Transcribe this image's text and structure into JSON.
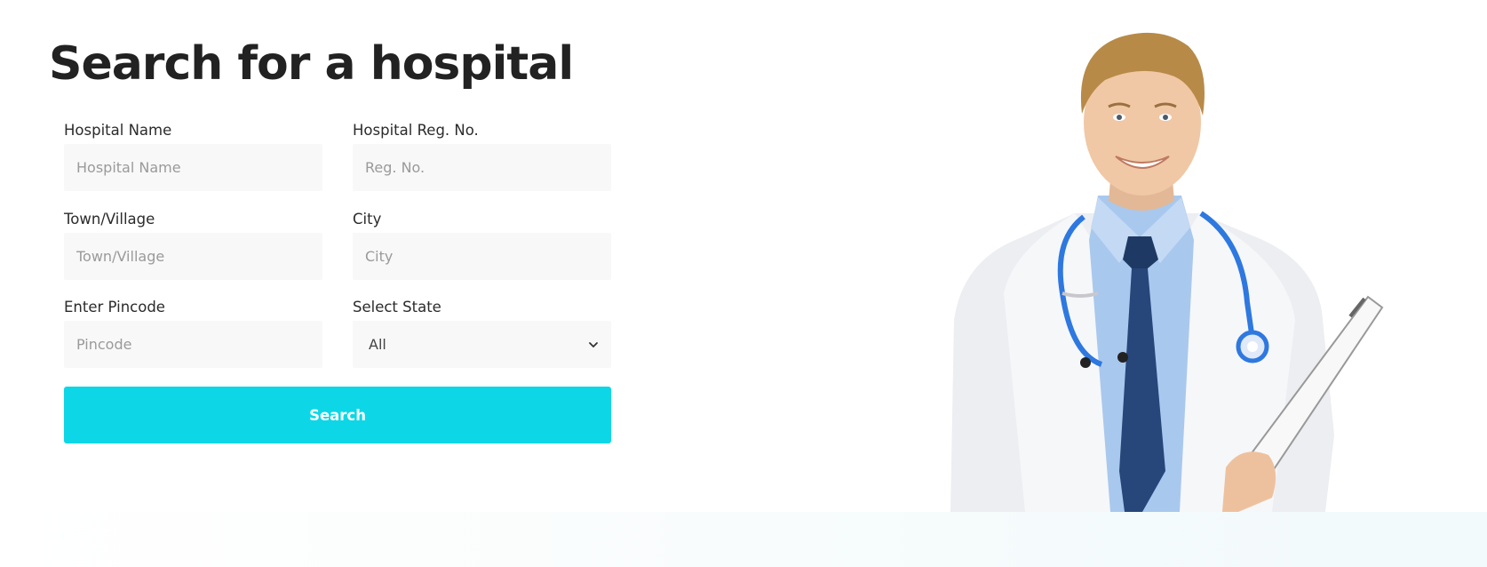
{
  "page": {
    "title": "Search for a hospital"
  },
  "form": {
    "hospital_name": {
      "label": "Hospital Name",
      "placeholder": "Hospital Name",
      "value": ""
    },
    "reg_no": {
      "label": "Hospital Reg. No.",
      "placeholder": "Reg. No.",
      "value": ""
    },
    "town": {
      "label": "Town/Village",
      "placeholder": "Town/Village",
      "value": ""
    },
    "city": {
      "label": "City",
      "placeholder": "City",
      "value": ""
    },
    "pincode": {
      "label": "Enter Pincode",
      "placeholder": "Pincode",
      "value": ""
    },
    "state": {
      "label": "Select State",
      "selected": "All"
    },
    "search_label": "Search"
  },
  "hero_image": {
    "icon": "doctor-illustration"
  },
  "colors": {
    "accent": "#0dd7e6",
    "field_bg": "#f8f8f8",
    "title": "#222222"
  }
}
